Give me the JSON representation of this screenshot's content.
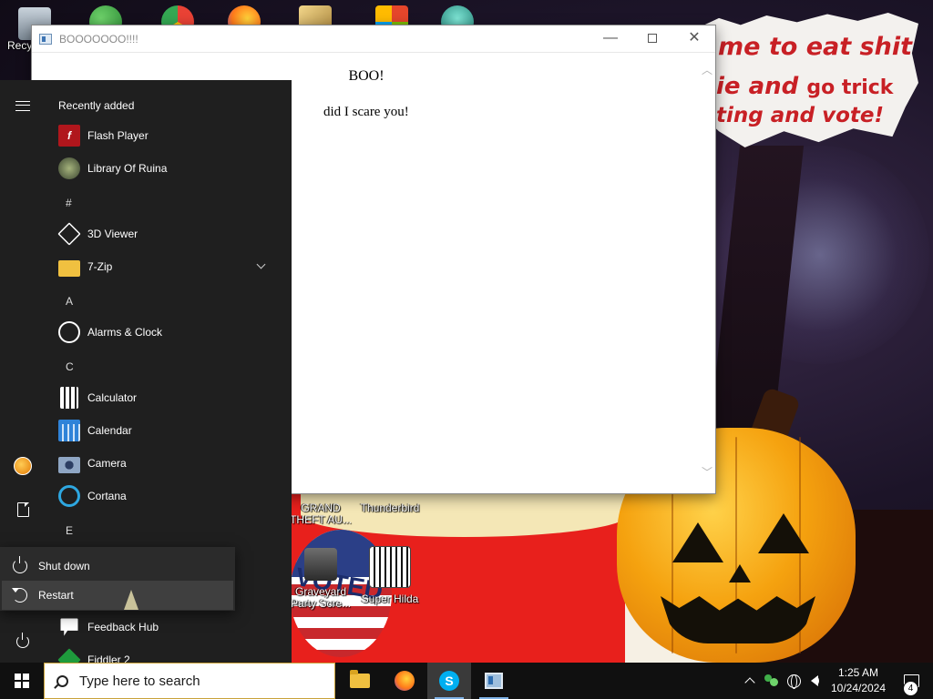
{
  "desktop": {
    "wallpaper_bubble_text": {
      "line1": "me to eat shit",
      "line2_a": "ie and",
      "line2_b": "go trick",
      "line3": "ting and vote!"
    },
    "icons": [
      {
        "label": "Recy",
        "name": "recycle-bin-icon",
        "color": "#9aa7b3"
      },
      {
        "label": "",
        "name": "people-icon",
        "color": "#3fae49"
      },
      {
        "label": "",
        "name": "chrome-icon",
        "color": "#e94235"
      },
      {
        "label": "",
        "name": "firefox-icon",
        "color": "#ff7a1a"
      },
      {
        "label": "",
        "name": "app-shortcut-icon",
        "color": "#d7b860"
      },
      {
        "label": "",
        "name": "office-icon",
        "color": "#e5462b"
      },
      {
        "label": "",
        "name": "anime-game-icon",
        "color": "#39b8a8"
      },
      {
        "label": "GRAND THEFT AU...",
        "name": "gta-shortcut"
      },
      {
        "label": "Thunderbird",
        "name": "thunderbird-shortcut"
      },
      {
        "label": "Graveyard Party Scre...",
        "name": "graveyard-party-shortcut"
      },
      {
        "label": "Super Hilda",
        "name": "super-hilda-shortcut"
      }
    ],
    "badge_text": "VOTED"
  },
  "window": {
    "title": "BOOOOOOO!!!!",
    "heading": "BOO!",
    "paragraph": "did I scare you!",
    "controls": {
      "minimize": "—",
      "close": "✕"
    }
  },
  "start_menu": {
    "recently_added_label": "Recently added",
    "recent": [
      {
        "label": "Flash Player",
        "icon": "flash-player-icon",
        "color": "#b0161c"
      },
      {
        "label": "Library Of Ruina",
        "icon": "library-of-ruina-icon",
        "color": "#5c6b4a"
      }
    ],
    "sections": [
      {
        "letter": "#",
        "items": [
          {
            "label": "3D Viewer",
            "icon": "3d-viewer-icon",
            "color": "#ffffff"
          },
          {
            "label": "7-Zip",
            "icon": "folder-icon",
            "color": "#f0c040",
            "expandable": true
          }
        ]
      },
      {
        "letter": "A",
        "items": [
          {
            "label": "Alarms & Clock",
            "icon": "alarm-clock-icon",
            "color": "#ffffff"
          }
        ]
      },
      {
        "letter": "C",
        "items": [
          {
            "label": "Calculator",
            "icon": "calculator-icon",
            "color": "#ffffff"
          },
          {
            "label": "Calendar",
            "icon": "calendar-icon",
            "color": "#2f83d8"
          },
          {
            "label": "Camera",
            "icon": "camera-icon",
            "color": "#8fa6c4"
          },
          {
            "label": "Cortana",
            "icon": "cortana-icon",
            "color": "#2ea7e0"
          }
        ]
      },
      {
        "letter": "E",
        "items": []
      }
    ],
    "after_flyout": [
      {
        "label": "Feedback Hub",
        "icon": "feedback-hub-icon",
        "color": "#ffffff"
      },
      {
        "label": "Fiddler 2",
        "icon": "fiddler-icon",
        "color": "#1e9b3c"
      }
    ],
    "power_flyout": {
      "shutdown_label": "Shut down",
      "restart_label": "Restart"
    }
  },
  "taskbar": {
    "search_placeholder": "Type here to search",
    "pinned": [
      {
        "name": "file-explorer-icon"
      },
      {
        "name": "firefox-taskbar-icon"
      },
      {
        "name": "skype-taskbar-icon",
        "glyph": "S"
      },
      {
        "name": "app-window-taskbar-icon"
      }
    ],
    "clock": {
      "time": "1:25 AM",
      "date": "10/24/2024"
    },
    "notification_count": "4"
  }
}
